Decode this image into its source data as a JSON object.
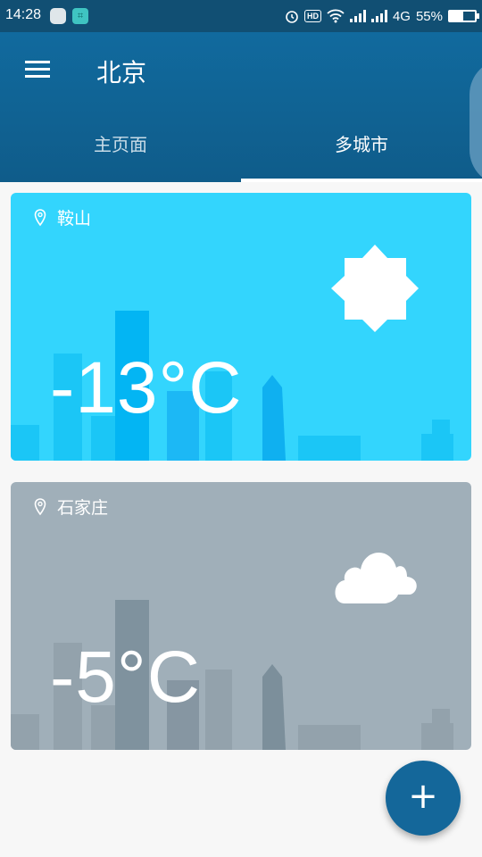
{
  "status_bar": {
    "time": "14:28",
    "network": "4G",
    "battery": "55%",
    "battery_level": 0.55,
    "icons": [
      "alarm-icon",
      "hd-icon",
      "wifi-icon",
      "signal-icon",
      "signal-icon",
      "battery-icon"
    ]
  },
  "app_bar": {
    "title": "北京",
    "menu_icon": "hamburger-menu-icon"
  },
  "tabs": [
    {
      "label": "主页面",
      "active": false
    },
    {
      "label": "多城市",
      "active": true
    }
  ],
  "cities": [
    {
      "name": "鞍山",
      "temperature": "-13°C",
      "condition_icon": "sun-icon",
      "background": "#33d5fd"
    },
    {
      "name": "石家庄",
      "temperature": "-5°C",
      "condition_icon": "cloud-icon",
      "background": "#a0afb9"
    }
  ],
  "fab": {
    "label": "+",
    "icon": "add-icon"
  }
}
